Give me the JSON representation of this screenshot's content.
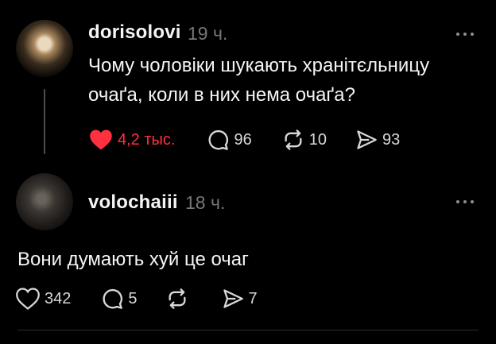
{
  "colors": {
    "background": "#000000",
    "text": "#f3f5f7",
    "muted": "#777777",
    "like": "#ff3040"
  },
  "posts": [
    {
      "username": "dorisolovi",
      "time": "19 ч.",
      "text": "Чому чоловіки шукають хранітєльницу очаґа, коли в них нема очаґа?",
      "likes": "4,2 тыс.",
      "liked": true,
      "comments": "96",
      "reposts": "10",
      "shares": "93"
    },
    {
      "username": "volochaiii",
      "time": "18 ч.",
      "text": "Вони думають хуй це очаг",
      "likes": "342",
      "liked": false,
      "comments": "5",
      "reposts": "",
      "shares": "7"
    }
  ],
  "icons": {
    "like": "heart-icon",
    "comment": "speech-bubble-icon",
    "repost": "repost-arrows-icon",
    "share": "paper-plane-icon",
    "more": "ellipsis-icon"
  }
}
